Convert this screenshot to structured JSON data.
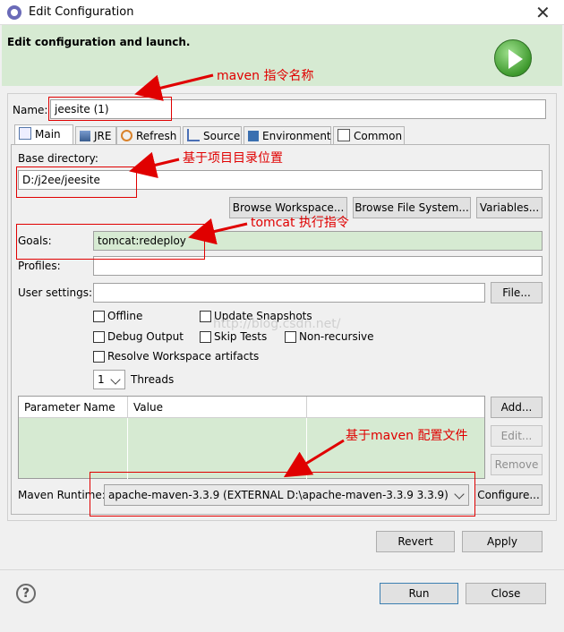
{
  "window": {
    "title": "Edit Configuration"
  },
  "banner": {
    "title": "Edit configuration and launch."
  },
  "name": {
    "label": "Name:",
    "value": "jeesite (1)"
  },
  "tabs": [
    {
      "label": "Main",
      "icon": "main-tab-icon"
    },
    {
      "label": "JRE",
      "icon": "jre-icon"
    },
    {
      "label": "Refresh",
      "icon": "refresh-icon"
    },
    {
      "label": "Source",
      "icon": "source-icon"
    },
    {
      "label": "Environment",
      "icon": "environment-icon"
    },
    {
      "label": "Common",
      "icon": "common-icon"
    }
  ],
  "main": {
    "base_dir_label": "Base directory:",
    "base_dir_value": "D:/j2ee/jeesite",
    "browse_workspace": "Browse Workspace...",
    "browse_fs": "Browse File System...",
    "variables": "Variables...",
    "goals_label": "Goals:",
    "goals_value": "tomcat:redeploy",
    "profiles_label": "Profiles:",
    "profiles_value": "",
    "user_settings_label": "User settings:",
    "user_settings_value": "",
    "file_button": "File...",
    "checkboxes": {
      "offline": "Offline",
      "update_snapshots": "Update Snapshots",
      "debug_output": "Debug Output",
      "skip_tests": "Skip Tests",
      "non_recursive": "Non-recursive",
      "resolve_workspace": "Resolve Workspace artifacts"
    },
    "threads_value": "1",
    "threads_label": "Threads",
    "table": {
      "columns": [
        "Parameter Name",
        "Value",
        ""
      ],
      "rows": []
    },
    "add_button": "Add...",
    "edit_button": "Edit...",
    "remove_button": "Remove",
    "runtime_label": "Maven Runtime:",
    "runtime_value": "apache-maven-3.3.9 (EXTERNAL D:\\apache-maven-3.3.9 3.3.9)",
    "configure_button": "Configure..."
  },
  "actions": {
    "revert": "Revert",
    "apply": "Apply",
    "run": "Run",
    "close": "Close"
  },
  "annotations": {
    "name": "maven 指令名称",
    "base_dir": "基于项目目录位置",
    "goals": "tomcat 执行指令",
    "runtime": "基于maven 配置文件"
  },
  "watermark": "http://blog.csdn.net/",
  "colors": {
    "banner": "#d6ead2",
    "annotation": "#e00000"
  }
}
